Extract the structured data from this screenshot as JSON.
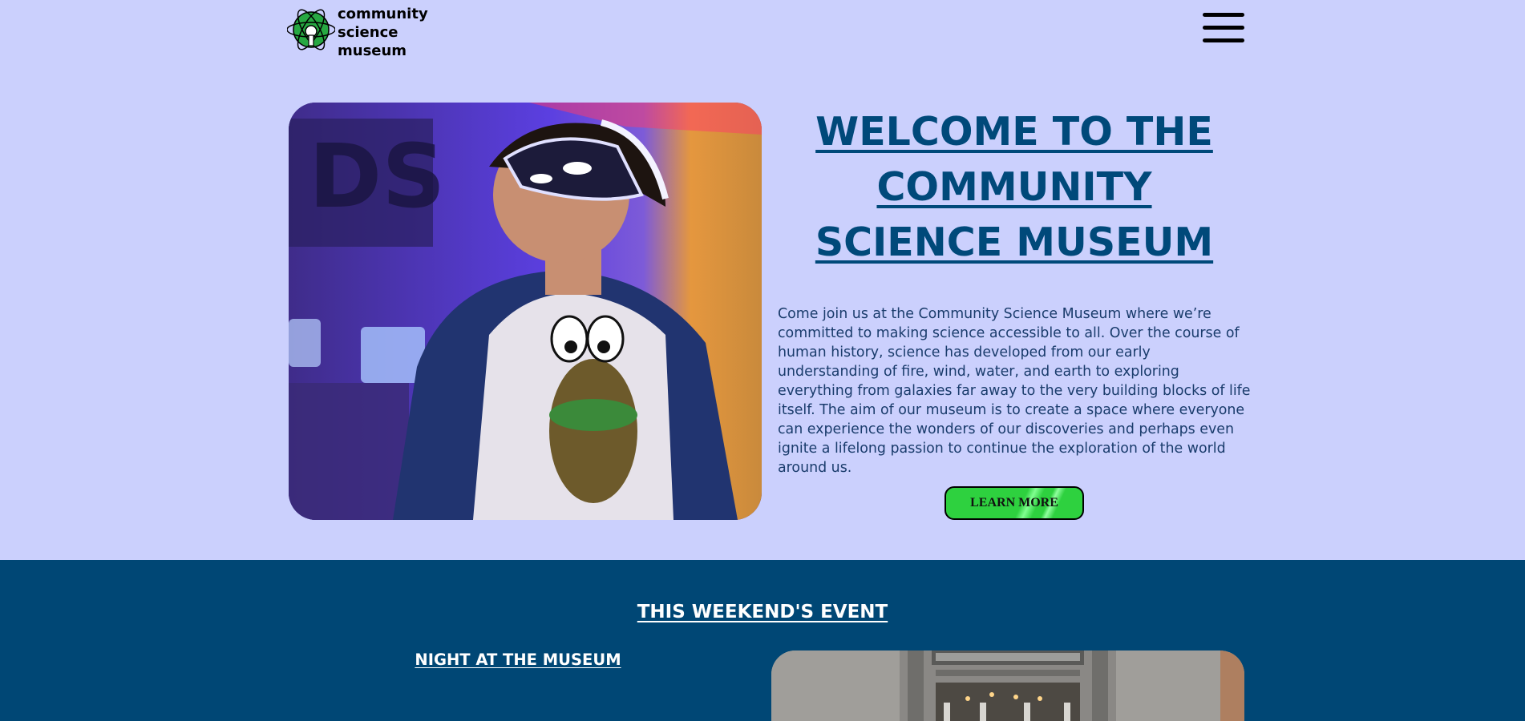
{
  "header": {
    "logo_lines": [
      "community",
      "science",
      "museum"
    ],
    "logo_icon": "atom-logo-icon",
    "menu_icon": "hamburger-menu-icon"
  },
  "hero": {
    "image": "person-wearing-vr-headset-photo",
    "title": "WELCOME TO THE COMMUNITY SCIENCE MUSEUM",
    "text": "Come join us at the Community Science Museum where we’re committed to making science accessible to all. Over the course of human history, science has developed from our early understanding of fire, wind, water, and earth to exploring everything from galaxies far away to the very building blocks of life itself. The aim of our museum is to create a space where everyone can experience the wonders of our discoveries and perhaps even ignite a lifelong passion to continue the exploration of the world around us.",
    "button_label": "LEARN MORE"
  },
  "event": {
    "heading": "THIS WEEKEND'S EVENT",
    "subheading": "NIGHT AT THE MUSEUM",
    "image": "museum-hall-interior-photo"
  },
  "colors": {
    "background": "#cbd0fd",
    "title": "#00497a",
    "event_background": "#004775",
    "button": "#2ed13f"
  }
}
